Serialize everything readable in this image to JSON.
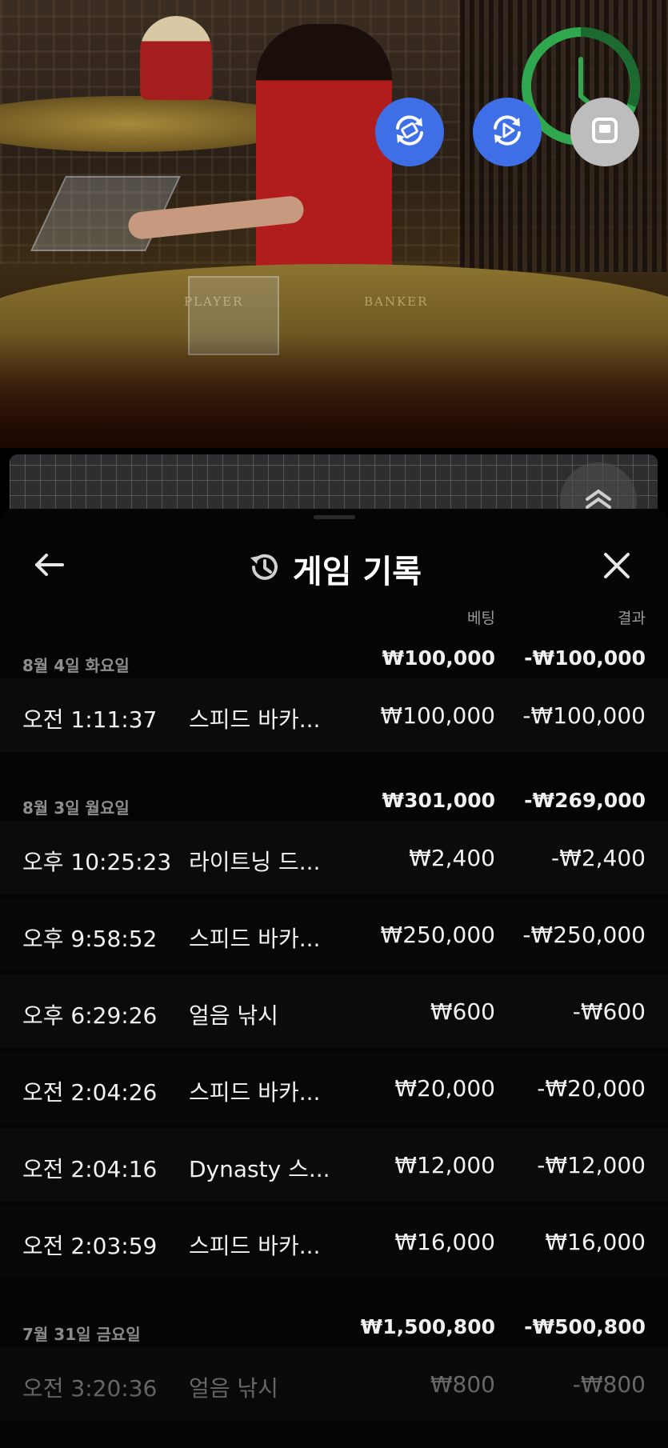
{
  "controls": {
    "icons": [
      "rotate-view-icon",
      "replay-video-icon",
      "stop-icon",
      "timer-clock-icon",
      "chevron-up-icon"
    ],
    "timer_color": "#2fa84f",
    "button_color": "#3f6fe6"
  },
  "video": {
    "table_labels": [
      "PLAYER",
      "BANKER"
    ]
  },
  "history": {
    "title": "게임 기록",
    "columns": {
      "bet": "베팅",
      "result": "결과"
    },
    "groups": [
      {
        "date": "8월 4일 화요일",
        "total_bet": "₩100,000",
        "total_result": "-₩100,000",
        "rows": [
          {
            "time": "오전 1:11:37",
            "game": "스피드 바카...",
            "bet": "₩100,000",
            "result": "-₩100,000"
          }
        ]
      },
      {
        "date": "8월 3일 월요일",
        "total_bet": "₩301,000",
        "total_result": "-₩269,000",
        "rows": [
          {
            "time": "오후 10:25:23",
            "game": "라이트닝 드...",
            "bet": "₩2,400",
            "result": "-₩2,400"
          },
          {
            "time": "오후 9:58:52",
            "game": "스피드 바카...",
            "bet": "₩250,000",
            "result": "-₩250,000"
          },
          {
            "time": "오후 6:29:26",
            "game": "얼음 낚시",
            "bet": "₩600",
            "result": "-₩600"
          },
          {
            "time": "오전 2:04:26",
            "game": "스피드 바카...",
            "bet": "₩20,000",
            "result": "-₩20,000"
          },
          {
            "time": "오전 2:04:16",
            "game": "Dynasty 스...",
            "bet": "₩12,000",
            "result": "-₩12,000"
          },
          {
            "time": "오전 2:03:59",
            "game": "스피드 바카...",
            "bet": "₩16,000",
            "result": "₩16,000"
          }
        ]
      },
      {
        "date": "7월 31일 금요일",
        "total_bet": "₩1,500,800",
        "total_result": "-₩500,800",
        "rows": [
          {
            "time": "오전 3:20:36",
            "game": "얼음 낚시",
            "bet": "₩800",
            "result": "-₩800"
          }
        ]
      }
    ]
  }
}
